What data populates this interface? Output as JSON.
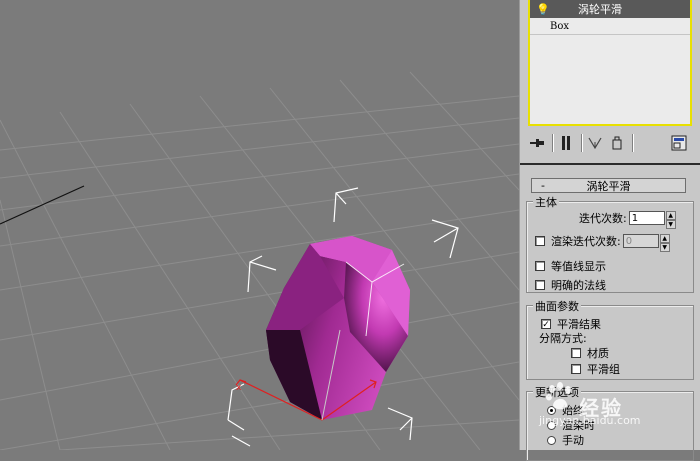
{
  "modifier_stack": {
    "items": [
      {
        "name": "涡轮平滑",
        "icon": "light-bulb-icon",
        "active": true
      },
      {
        "name": "Box",
        "active": false
      }
    ],
    "tools": [
      "pin-stack-icon",
      "show-end-result-icon",
      "make-unique-icon",
      "remove-modifier-icon",
      "configure-modifier-sets-icon"
    ]
  },
  "rollout": {
    "collapse_symbol": "-",
    "title": "涡轮平滑"
  },
  "main_group": {
    "title": "主体",
    "iterations_label": "迭代次数:",
    "iterations_value": "1",
    "render_iters_label": "渲染迭代次数:",
    "render_iters_value": "0",
    "render_iters_checked": false,
    "isoline_label": "等值线显示",
    "isoline_checked": false,
    "explicit_normals_label": "明确的法线",
    "explicit_normals_checked": false
  },
  "surface_group": {
    "title": "曲面参数",
    "smooth_result_label": "平滑结果",
    "smooth_result_checked": true,
    "separate_by_label": "分隔方式:",
    "materials_label": "材质",
    "materials_checked": false,
    "smoothing_groups_label": "平滑组",
    "smoothing_groups_checked": false
  },
  "update_group": {
    "title": "更新选项",
    "options": [
      {
        "label": "始终",
        "selected": true
      },
      {
        "label": "渲染时",
        "selected": false
      },
      {
        "label": "手动",
        "selected": false
      }
    ]
  },
  "colors": {
    "viewport_bg": "#7b7b7b",
    "grid": "#8d8d8d",
    "stack_highlight": "#e8e000",
    "object_magenta": "#c040b0",
    "gizmo_x": "#e02020"
  },
  "watermark": {
    "main": "经验",
    "sub": "jingyan.baidu.com"
  }
}
